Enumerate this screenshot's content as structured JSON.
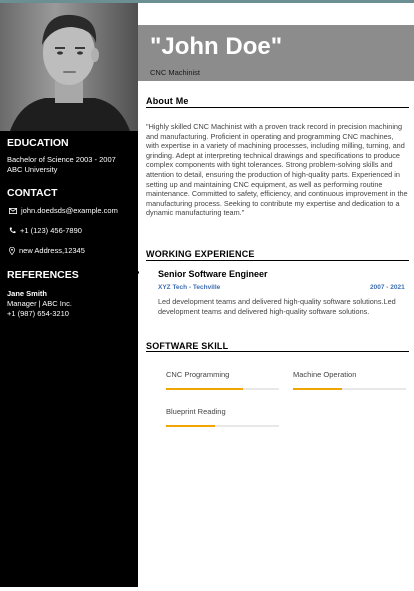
{
  "header": {
    "name": "\"John Doe\"",
    "job_title": "CNC Machinist"
  },
  "sidebar": {
    "education": {
      "heading": "EDUCATION",
      "degree": "Bachelor of Science 2003 - 2007",
      "school": "ABC University"
    },
    "contact": {
      "heading": "CONTACT",
      "email": "john.doedsds@example.com",
      "phone": "+1 (123) 456-7890",
      "address": "new Address,12345"
    },
    "references": {
      "heading": "REFERENCES",
      "name": "Jane Smith",
      "role": "Manager | ABC Inc.",
      "phone": "+1 (987) 654-3210"
    }
  },
  "about": {
    "heading": "About Me",
    "text": "\"Highly skilled CNC Machinist with a proven track record in precision machining and manufacturing. Proficient in operating and programming CNC machines, with expertise in a variety of machining processes, including milling, turning, and grinding. Adept at interpreting technical drawings and specifications to produce complex components with tight tolerances. Strong problem-solving skills and attention to detail, ensuring the production of high-quality parts. Experienced in setting up and maintaining CNC equipment, as well as performing routine maintenance. Committed to safety, efficiency, and continuous improvement in the manufacturing process. Seeking to contribute my expertise and dedication to a dynamic manufacturing team.\""
  },
  "experience": {
    "heading": "WORKING EXPERIENCE",
    "jobs": [
      {
        "title": "Senior Software Engineer",
        "company": "XYZ Tech - Techville",
        "dates": "2007 - 2021",
        "description": "Led development teams and delivered high-quality software solutions.Led development teams and delivered high-quality software solutions."
      }
    ]
  },
  "skills": {
    "heading": "SOFTWARE SKILL",
    "items": [
      {
        "label": "CNC Programming",
        "level": 0.68
      },
      {
        "label": "Machine Operation",
        "level": 0.43
      },
      {
        "label": "Blueprint Reading",
        "level": 0.43
      }
    ]
  },
  "colors": {
    "sidebar": "#000000",
    "header_band": "#8c8c8c",
    "skill_bar": "#f0a500",
    "accent_text": "#3f6fb0"
  }
}
